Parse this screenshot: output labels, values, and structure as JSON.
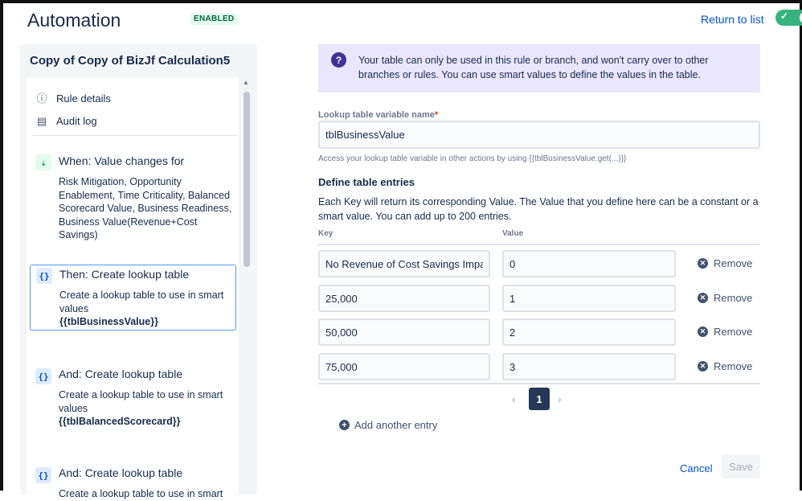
{
  "header": {
    "title": "Automation",
    "status": "ENABLED",
    "return_link": "Return to list",
    "toggle_on": true
  },
  "sidebar": {
    "rule_name": "Copy of Copy of BizJf Calculation5",
    "nav": [
      {
        "label": "Rule details",
        "icon": "info-icon"
      },
      {
        "label": "Audit log",
        "icon": "document-icon"
      }
    ],
    "steps": [
      {
        "title": "When: Value changes for",
        "description": "Risk Mitigation, Opportunity Enablement, Time Criticality, Balanced Scorecard Value, Business Readiness, Business Value(Revenue+Cost Savings)",
        "icon": "trigger-icon"
      },
      {
        "title": "Then: Create lookup table",
        "description": "Create a lookup table to use in smart values",
        "variable": "{{tblBusinessValue}}",
        "icon": "braces-icon",
        "selected": true
      },
      {
        "title": "And: Create lookup table",
        "description": "Create a lookup table to use in smart values",
        "variable": "{{tblBalancedScorecard}}",
        "icon": "braces-icon"
      },
      {
        "title": "And: Create lookup table",
        "description": "Create a lookup table to use in smart",
        "icon": "braces-icon"
      }
    ]
  },
  "main": {
    "info_text": "Your table can only be used in this rule or branch, and won't carry over to other branches or rules. You can use smart values to define the values in the table.",
    "variable_field": {
      "label": "Lookup table variable name",
      "required_mark": "*",
      "value": "tblBusinessValue",
      "help": "Access your lookup table variable in other actions by using {{tblBusinessValue.get(...)}}"
    },
    "section": {
      "heading": "Define table entries",
      "description": "Each Key will return its corresponding Value. The Value that you define here can be a constant or a smart value. You can add up to 200 entries."
    },
    "table": {
      "key_header": "Key",
      "value_header": "Value",
      "remove_label": "Remove",
      "rows": [
        {
          "key": "No Revenue of Cost Savings Impact",
          "value": "0"
        },
        {
          "key": "25,000",
          "value": "1"
        },
        {
          "key": "50,000",
          "value": "2"
        },
        {
          "key": "75,000",
          "value": "3"
        }
      ]
    },
    "pagination": {
      "current": "1",
      "prev": "‹",
      "next": "›"
    },
    "add_entry": "Add another entry",
    "cancel": "Cancel",
    "save": "Save"
  }
}
